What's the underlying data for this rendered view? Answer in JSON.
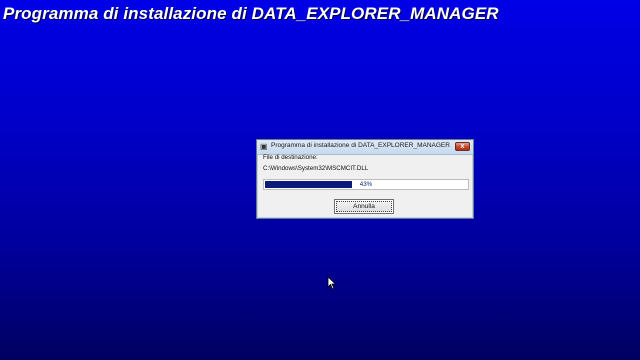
{
  "background": {
    "title": "Programma di installazione di DATA_EXPLORER_MANAGER",
    "colors": {
      "top": "#0000e6",
      "bottom": "#000060"
    }
  },
  "dialog": {
    "title": "Programma di installazione di DATA_EXPLORER_MANAGER",
    "title_icon": "installer-icon",
    "close_label": "x",
    "destination_label": "File di destinazione:",
    "file_path": "C:\\Windows\\System32\\MSCMCIT.DLL",
    "progress": {
      "percent": 43,
      "label": "43%"
    },
    "cancel_label": "Annulla",
    "colors": {
      "progress_fill": "#0a1b7a",
      "close_button": "#c7432b"
    }
  },
  "cursor": {
    "icon": "mouse-pointer-icon"
  }
}
